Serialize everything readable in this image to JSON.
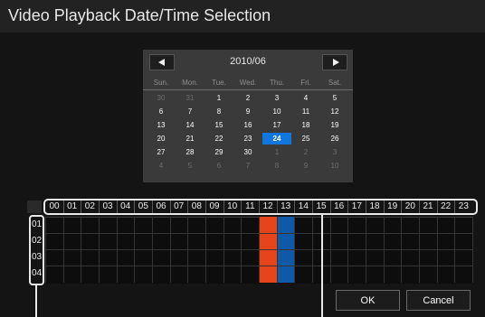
{
  "window": {
    "title": "Video Playback Date/Time Selection"
  },
  "calendar": {
    "month_label": "2010/06",
    "prev_icon": "triangle-left-icon",
    "next_icon": "triangle-right-icon",
    "weekdays": [
      "Sun.",
      "Mon.",
      "Tue.",
      "Wed.",
      "Thu.",
      "Fri.",
      "Sat."
    ],
    "weeks": [
      [
        {
          "d": "30",
          "o": true
        },
        {
          "d": "31",
          "o": true
        },
        {
          "d": "1"
        },
        {
          "d": "2"
        },
        {
          "d": "3"
        },
        {
          "d": "4"
        },
        {
          "d": "5"
        }
      ],
      [
        {
          "d": "6"
        },
        {
          "d": "7"
        },
        {
          "d": "8"
        },
        {
          "d": "9"
        },
        {
          "d": "10"
        },
        {
          "d": "11"
        },
        {
          "d": "12"
        }
      ],
      [
        {
          "d": "13"
        },
        {
          "d": "14"
        },
        {
          "d": "15"
        },
        {
          "d": "16"
        },
        {
          "d": "17"
        },
        {
          "d": "18"
        },
        {
          "d": "19"
        }
      ],
      [
        {
          "d": "20"
        },
        {
          "d": "21"
        },
        {
          "d": "22"
        },
        {
          "d": "23"
        },
        {
          "d": "24",
          "s": true
        },
        {
          "d": "25"
        },
        {
          "d": "26"
        }
      ],
      [
        {
          "d": "27"
        },
        {
          "d": "28"
        },
        {
          "d": "29"
        },
        {
          "d": "30"
        },
        {
          "d": "1",
          "o": true
        },
        {
          "d": "2",
          "o": true
        },
        {
          "d": "3",
          "o": true
        }
      ],
      [
        {
          "d": "4",
          "o": true
        },
        {
          "d": "5",
          "o": true
        },
        {
          "d": "6",
          "o": true
        },
        {
          "d": "7",
          "o": true
        },
        {
          "d": "8",
          "o": true
        },
        {
          "d": "9",
          "o": true
        },
        {
          "d": "10",
          "o": true
        }
      ]
    ],
    "selected_color": "#1177dd"
  },
  "timeline": {
    "hours": [
      "00",
      "01",
      "02",
      "03",
      "04",
      "05",
      "06",
      "07",
      "08",
      "09",
      "10",
      "11",
      "12",
      "13",
      "14",
      "15",
      "16",
      "17",
      "18",
      "19",
      "20",
      "21",
      "22",
      "23"
    ],
    "channels": [
      "01",
      "02",
      "03",
      "04"
    ],
    "recordings": [
      {
        "hour": 12,
        "color": "#e8441c"
      },
      {
        "hour": 13,
        "color": "#0e5aa8"
      }
    ]
  },
  "buttons": {
    "ok": "OK",
    "cancel": "Cancel"
  }
}
